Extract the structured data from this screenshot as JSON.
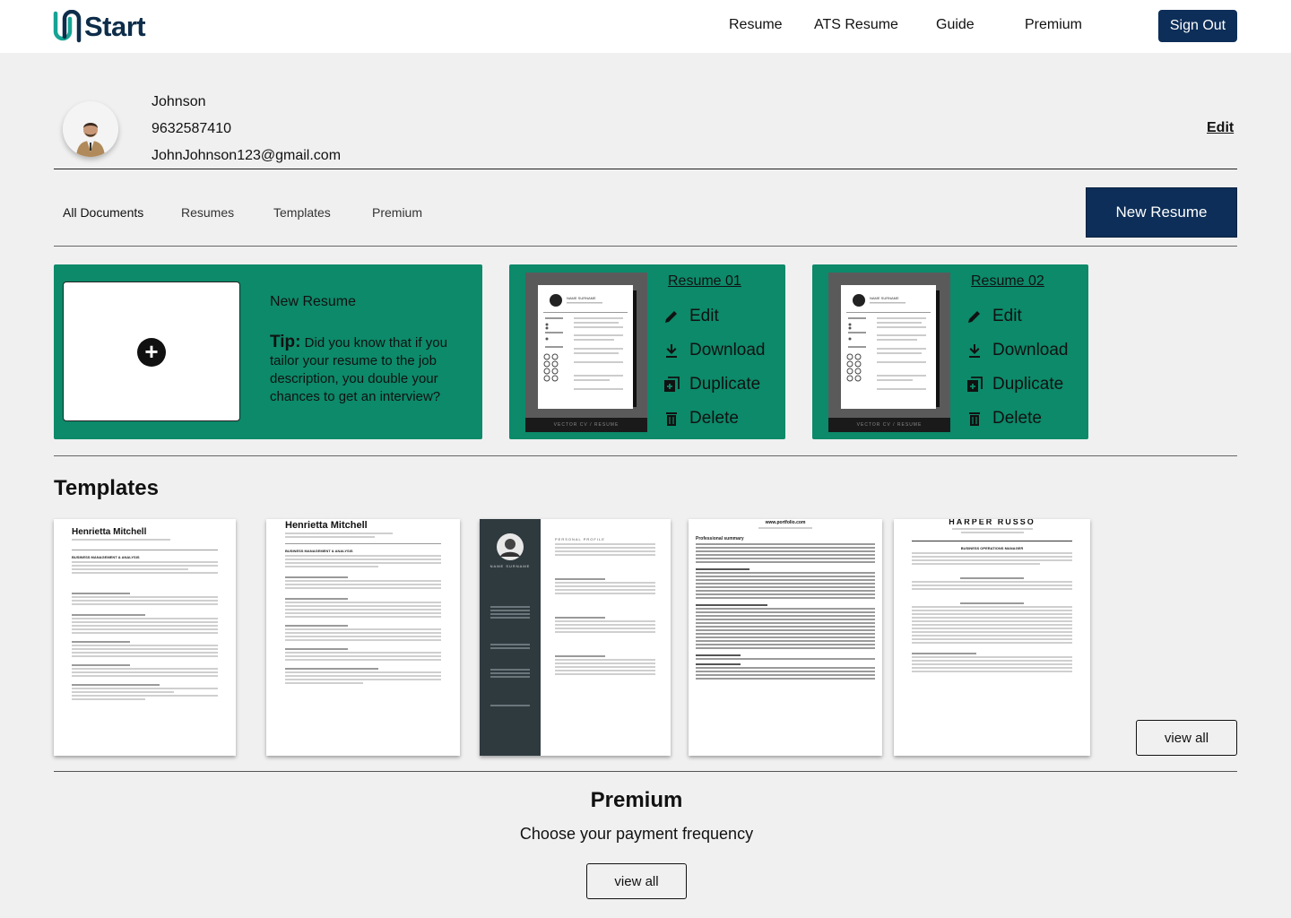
{
  "header": {
    "logo_text": "Start",
    "nav": [
      "Resume",
      "ATS Resume",
      "Guide",
      "Premium"
    ],
    "sign_out": "Sign Out"
  },
  "profile": {
    "name": "Johnson",
    "phone": "9632587410",
    "email": "JohnJohnson123@gmail.com",
    "edit_label": "Edit"
  },
  "tabs": [
    "All Documents",
    "Resumes",
    "Templates",
    "Premium"
  ],
  "new_resume_button": "New Resume",
  "new_card": {
    "title": "New Resume",
    "tip_label": "Tip:",
    "tip_text": "Did you know that if you tailor your resume to the job description, you double your chances to get an interview?"
  },
  "resumes": [
    {
      "title": "Resume 01",
      "actions": [
        "Edit",
        "Download",
        "Duplicate",
        "Delete"
      ],
      "thumb_caption": "VECTOR CV / RESUME",
      "thumb_name": "NAME SURNAME"
    },
    {
      "title": "Resume 02",
      "actions": [
        "Edit",
        "Download",
        "Duplicate",
        "Delete"
      ],
      "thumb_caption": "VECTOR CV / RESUME",
      "thumb_name": "NAME SURNAME"
    }
  ],
  "templates_section": {
    "title": "Templates",
    "view_all": "view all",
    "items": [
      {
        "name": "Henrietta Mitchell",
        "heading": "BUSINESS MANAGEMENT & ANALYSIS"
      },
      {
        "name": "Henrietta Mitchell",
        "heading": "BUSINESS MANAGEMENT & ANALYSIS"
      },
      {
        "name": "NAME SURNAME",
        "heading": "PERSONAL PROFILE"
      },
      {
        "name": "www.portfolio.com",
        "heading": "Professional summary"
      },
      {
        "name": "HARPER RUSSO",
        "heading": "BUSINESS OPERATIONS MANAGER"
      }
    ]
  },
  "premium": {
    "title": "Premium",
    "subtitle": "Choose your payment frequency",
    "view_all": "view all"
  },
  "colors": {
    "navy": "#0c2e58",
    "card_green": "#0c8a6a",
    "logo_teal": "#16a394",
    "background": "#f0f0f0"
  }
}
